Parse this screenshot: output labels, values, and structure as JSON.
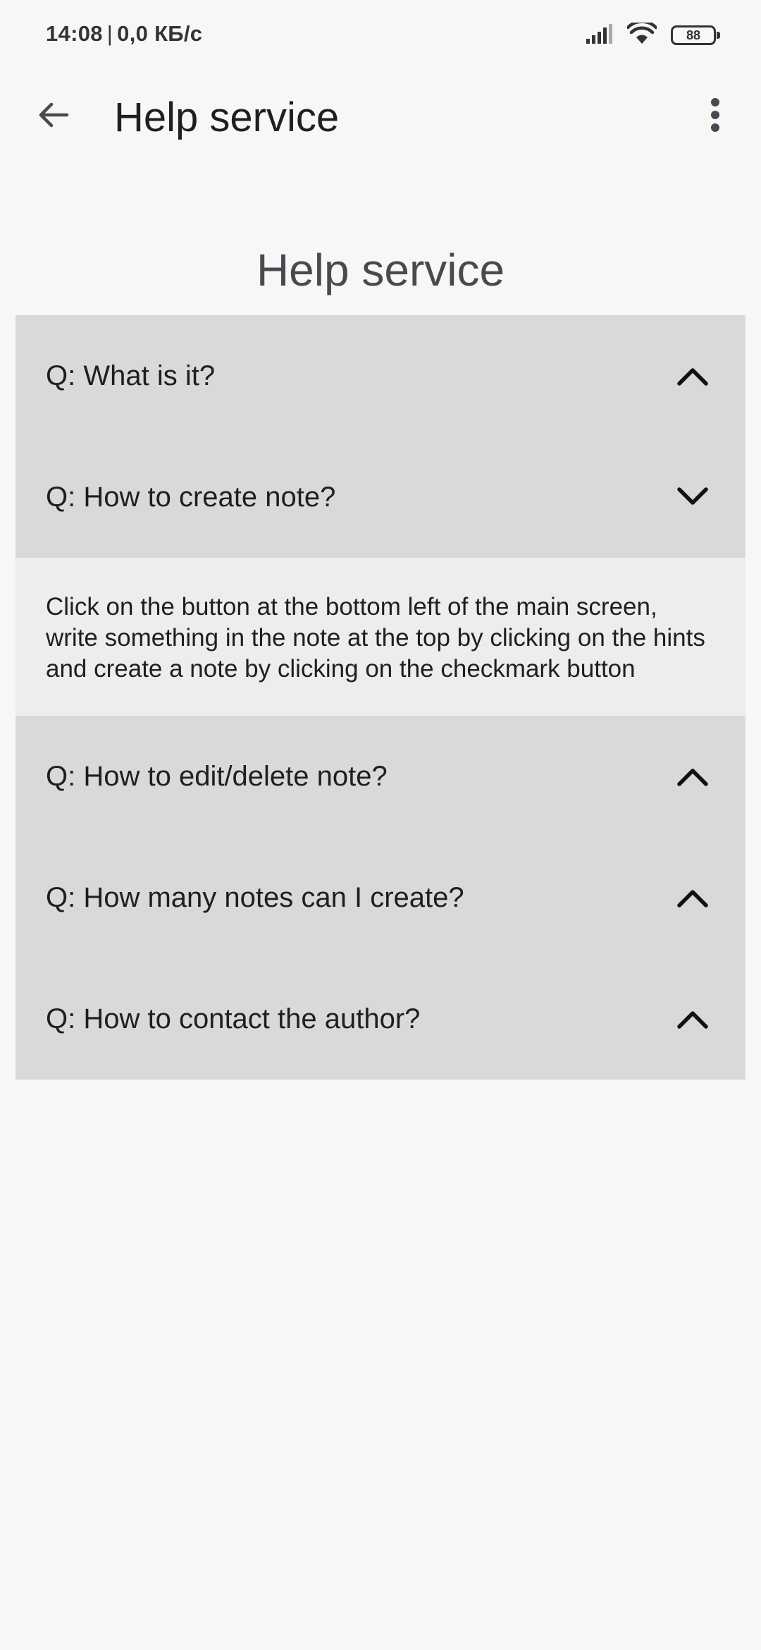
{
  "status_bar": {
    "time": "14:08",
    "separator": "|",
    "network_speed": "0,0 КБ/с",
    "battery_level": "88",
    "icons": [
      "signal-icon",
      "wifi-icon",
      "battery-icon"
    ]
  },
  "app_bar": {
    "title": "Help service",
    "back_icon": "arrow-left-icon",
    "menu_icon": "more-vert-icon"
  },
  "page": {
    "heading": "Help service"
  },
  "faq": {
    "items": [
      {
        "question": "Q: What is it?",
        "expanded": false,
        "chevron": "chevron-up-icon"
      },
      {
        "question": "Q: How to create note?",
        "expanded": true,
        "chevron": "chevron-down-icon",
        "answer": "Click on the button at the bottom left of the main screen, write something in the note at the top by clicking on the hints and create a note by clicking on the checkmark button"
      },
      {
        "question": "Q: How to edit/delete note?",
        "expanded": false,
        "chevron": "chevron-up-icon"
      },
      {
        "question": "Q: How many notes can I create?",
        "expanded": false,
        "chevron": "chevron-up-icon"
      },
      {
        "question": "Q: How to contact the author?",
        "expanded": false,
        "chevron": "chevron-up-icon"
      }
    ]
  },
  "colors": {
    "background": "#f8f7f5",
    "question_bg": "#dad8d9",
    "answer_bg": "#eeeced",
    "text": "#1f1f1f",
    "heading": "#4a4850"
  }
}
